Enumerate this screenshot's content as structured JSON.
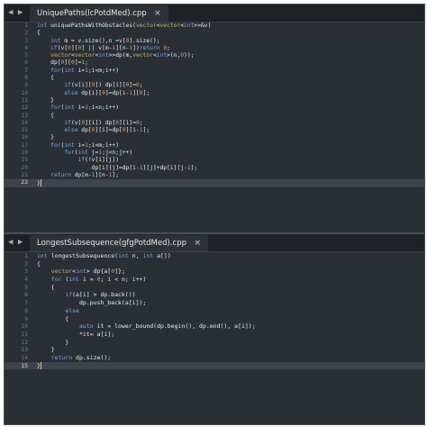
{
  "editor1": {
    "tab_label": "UniquePaths(lcPotdMed).cpp",
    "close_glyph": "×",
    "nav_glyph": "◀ ▶",
    "lines": [
      {
        "n": "1",
        "code": "int uniquePathsWithObstacles(vector<vector<int>>&v)"
      },
      {
        "n": "2",
        "code": "{"
      },
      {
        "n": "3",
        "code": "    int m = v.size(),n =v[0].size();"
      },
      {
        "n": "4",
        "code": "    if(v[0][0] || v[m-1][n-1])return 0;"
      },
      {
        "n": "5",
        "code": "    vector<vector<int>>dp(m,vector<int>(n,0));"
      },
      {
        "n": "6",
        "code": "    dp[0][0]=1;"
      },
      {
        "n": "7",
        "code": "    for(int i=1;i<m;i++)"
      },
      {
        "n": "8",
        "code": "    {"
      },
      {
        "n": "9",
        "code": "        if(v[i][0]) dp[i][0]=0;"
      },
      {
        "n": "10",
        "code": "        else dp[i][0]=dp[i-1][0];"
      },
      {
        "n": "11",
        "code": "    }"
      },
      {
        "n": "12",
        "code": "    for(int i=1;i<n;i++)"
      },
      {
        "n": "13",
        "code": "    {"
      },
      {
        "n": "14",
        "code": "        if(v[0][i]) dp[0][i]=0;"
      },
      {
        "n": "15",
        "code": "        else dp[0][i]=dp[0][i-1];"
      },
      {
        "n": "16",
        "code": "    }"
      },
      {
        "n": "17",
        "code": "    for(int i=1;i<m;i++)"
      },
      {
        "n": "18",
        "code": "        for(int j=1;j<n;j++)"
      },
      {
        "n": "19",
        "code": "            if(!v[i][j])"
      },
      {
        "n": "20",
        "code": "                dp[i][j]=dp[i-1][j]+dp[i][j-1];"
      },
      {
        "n": "21",
        "code": "    return dp[m-1][n-1];"
      },
      {
        "n": "22",
        "code": "}"
      }
    ],
    "current_line": "22"
  },
  "editor2": {
    "tab_label": "LongestSubsequence(gfgPotdMed).cpp",
    "close_glyph": "×",
    "nav_glyph": "◀ ▶",
    "lines": [
      {
        "n": "1",
        "code": "int longestSubsequence(int n, int a[])"
      },
      {
        "n": "2",
        "code": "{"
      },
      {
        "n": "3",
        "code": "    vector<int> dp{a[0]};"
      },
      {
        "n": "4",
        "code": "    for (int i = 0; i < n; i++)"
      },
      {
        "n": "5",
        "code": "    {"
      },
      {
        "n": "6",
        "code": "        if(a[i] > dp.back())"
      },
      {
        "n": "7",
        "code": "            dp.push_back(a[i]);"
      },
      {
        "n": "8",
        "code": "        else"
      },
      {
        "n": "9",
        "code": "        {"
      },
      {
        "n": "10",
        "code": "            auto it = lower_bound(dp.begin(), dp.end(), a[i]);"
      },
      {
        "n": "11",
        "code": "            *it= a[i];"
      },
      {
        "n": "12",
        "code": "        }"
      },
      {
        "n": "13",
        "code": "    }"
      },
      {
        "n": "14",
        "code": "    return dp.size();"
      },
      {
        "n": "15",
        "code": "}"
      }
    ],
    "current_line": "15"
  },
  "colors": {
    "editor_bg": "#2a2f36",
    "tab_bg": "#2d3239",
    "keyword": "#7aa6e8",
    "number": "#e69a5a"
  }
}
